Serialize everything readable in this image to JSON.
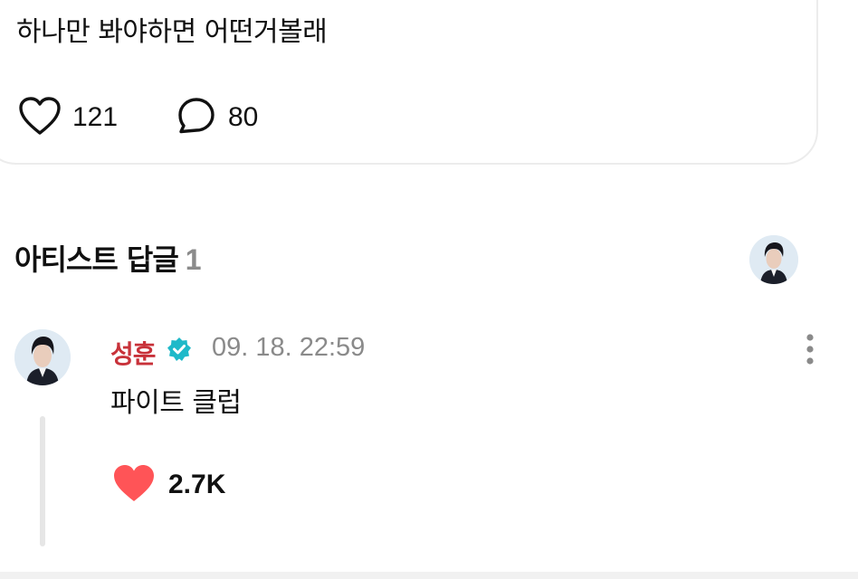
{
  "post": {
    "text": "하나만 봐야하면 어떤거볼래",
    "likes": "121",
    "comments": "80"
  },
  "artist_replies": {
    "title": "아티스트 답글",
    "count": "1"
  },
  "reply": {
    "author": "성훈",
    "timestamp": "09. 18. 22:59",
    "text": "파이트 클럽",
    "likes": "2.7K"
  },
  "colors": {
    "author": "#c8323a",
    "verified": "#1fb9c9",
    "heart_filled": "#ff5457"
  },
  "icons": [
    "heart-outline-icon",
    "comment-bubble-icon",
    "verified-badge-icon",
    "more-vertical-icon",
    "heart-filled-icon"
  ]
}
